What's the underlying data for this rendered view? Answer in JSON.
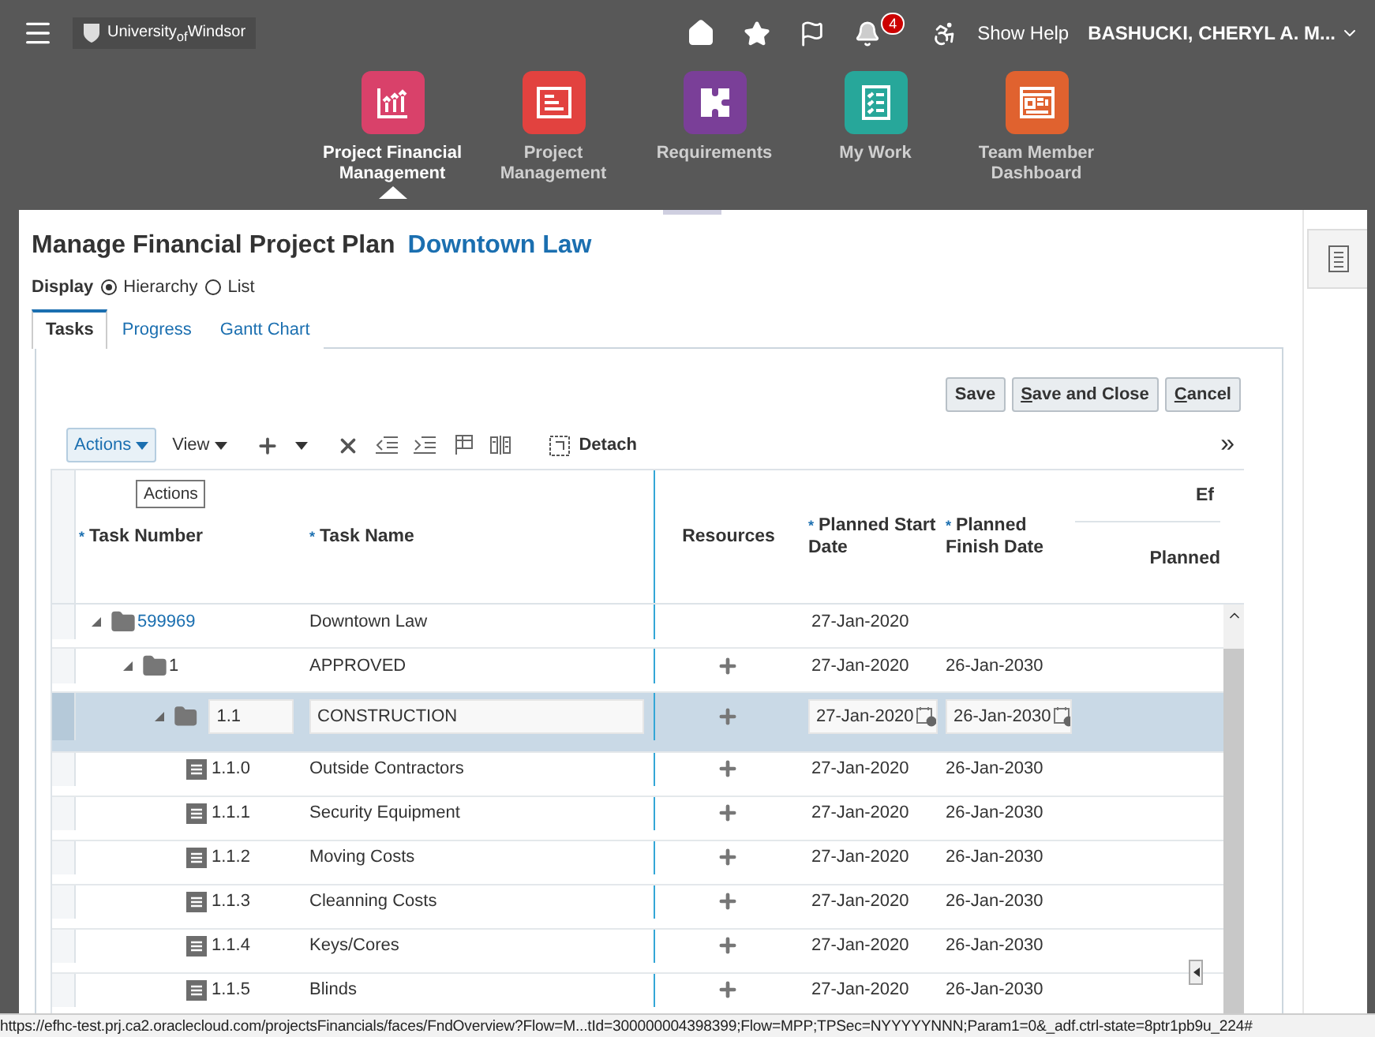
{
  "header": {
    "logo": "University$_{of}$Windsor",
    "notification_count": "4",
    "help": "Show Help",
    "user": "BASHUCKI, CHERYL A. M..."
  },
  "nav": [
    {
      "label": "Project Financial Management",
      "kind": "financial",
      "color": "#d9416a",
      "selected": true
    },
    {
      "label": "Project Management",
      "kind": "gantt",
      "color": "#e2423f",
      "selected": false
    },
    {
      "label": "Requirements",
      "kind": "puzzle",
      "color": "#7a3f98",
      "selected": false
    },
    {
      "label": "My Work",
      "kind": "checklist",
      "color": "#27a79a",
      "selected": false
    },
    {
      "label": "Team Member Dashboard",
      "kind": "dashboard",
      "color": "#e0622f",
      "selected": false
    }
  ],
  "page": {
    "title": "Manage Financial Project Plan",
    "project": "Downtown Law"
  },
  "display": {
    "label": "Display",
    "options": [
      {
        "label": "Hierarchy",
        "selected": true
      },
      {
        "label": "List",
        "selected": false
      }
    ]
  },
  "tabs": [
    {
      "label": "Tasks",
      "selected": true
    },
    {
      "label": "Progress",
      "selected": false
    },
    {
      "label": "Gantt Chart",
      "selected": false
    }
  ],
  "buttons": [
    {
      "label": "Save",
      "access_key": false
    },
    {
      "label": "Save and Close",
      "access_key": true
    },
    {
      "label": "Cancel",
      "access_key": true
    }
  ],
  "toolbar": {
    "actions": "Actions",
    "view": "View",
    "detach": "Detach",
    "more": "»",
    "tooltip": "Actions"
  },
  "table": {
    "columns": [
      {
        "label": "Task Number",
        "marker": "*"
      },
      {
        "label": "Task Name",
        "marker": "*"
      },
      {
        "label": "Resources"
      },
      {
        "label": "Planned Start Date",
        "marker": "*"
      },
      {
        "label": "Planned Finish Date",
        "marker": "*"
      }
    ],
    "group_header": "Ef",
    "group_subheader": "Planned",
    "rows": [
      {
        "number": "599969",
        "name": "Downtown Law",
        "kind": "folder",
        "link": true,
        "expanded": true,
        "selected": false,
        "add_resource": false,
        "start": "27-Jan-2020",
        "children": [
          {
            "number": "1",
            "name": "APPROVED",
            "kind": "folder",
            "link": false,
            "expanded": true,
            "selected": false,
            "add_resource": true,
            "start": "27-Jan-2020",
            "finish": "26-Jan-2030",
            "children": [
              {
                "number": "1.1",
                "name": "CONSTRUCTION",
                "kind": "folder",
                "link": false,
                "expanded": true,
                "selected": true,
                "add_resource": true,
                "start": "27-Jan-2020",
                "finish": "26-Jan-2030",
                "children": [
                  {
                    "number": "1.1.0",
                    "name": "Outside Contractors",
                    "kind": "task",
                    "link": false,
                    "selected": false,
                    "add_resource": true,
                    "start": "27-Jan-2020",
                    "finish": "26-Jan-2030"
                  },
                  {
                    "number": "1.1.1",
                    "name": "Security Equipment",
                    "kind": "task",
                    "link": false,
                    "selected": false,
                    "add_resource": true,
                    "start": "27-Jan-2020",
                    "finish": "26-Jan-2030"
                  },
                  {
                    "number": "1.1.2",
                    "name": "Moving Costs",
                    "kind": "task",
                    "link": false,
                    "selected": false,
                    "add_resource": true,
                    "start": "27-Jan-2020",
                    "finish": "26-Jan-2030"
                  },
                  {
                    "number": "1.1.3",
                    "name": "Cleanning Costs",
                    "kind": "task",
                    "link": false,
                    "selected": false,
                    "add_resource": true,
                    "start": "27-Jan-2020",
                    "finish": "26-Jan-2030"
                  },
                  {
                    "number": "1.1.4",
                    "name": "Keys/Cores",
                    "kind": "task",
                    "link": false,
                    "selected": false,
                    "add_resource": true,
                    "start": "27-Jan-2020",
                    "finish": "26-Jan-2030"
                  },
                  {
                    "number": "1.1.5",
                    "name": "Blinds",
                    "kind": "task",
                    "link": false,
                    "selected": false,
                    "add_resource": true,
                    "start": "27-Jan-2020",
                    "finish": "26-Jan-2030"
                  }
                ]
              }
            ]
          }
        ]
      }
    ]
  },
  "status_bar": "https://efhc-test.prj.ca2.oraclecloud.com/projectsFinancials/faces/FndOverview?Flow=M...tId=300000004398399;Flow=MPP;TPSec=NYYYYYNNN;Param1=0&_adf.ctrl-state=8ptr1pb9u_224#"
}
